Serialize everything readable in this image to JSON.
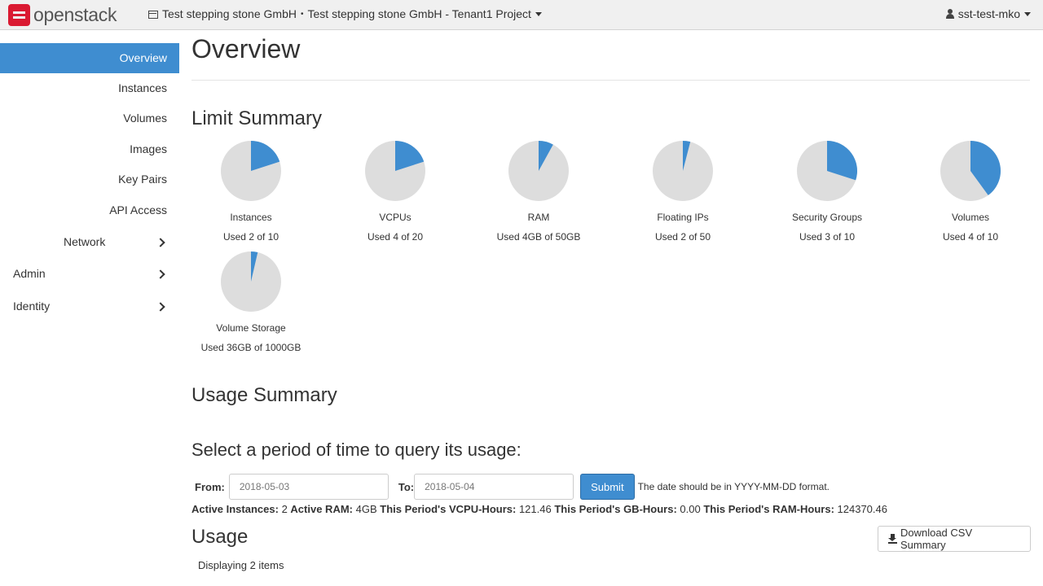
{
  "brand": {
    "logo_text": "openstack"
  },
  "header": {
    "project": "Test stepping stone GmbH",
    "separator": "•",
    "project_detail": "Test stepping stone GmbH - Tenant1 Project",
    "user": "sst-test-mko"
  },
  "sidebar": {
    "items": [
      {
        "label": "Overview",
        "active": true
      },
      {
        "label": "Instances"
      },
      {
        "label": "Volumes"
      },
      {
        "label": "Images"
      },
      {
        "label": "Key Pairs"
      },
      {
        "label": "API Access"
      }
    ],
    "groups": [
      {
        "label": "Network"
      },
      {
        "label": "Admin"
      },
      {
        "label": "Identity"
      }
    ]
  },
  "page": {
    "title": "Overview",
    "limit_summary_title": "Limit Summary",
    "usage_summary_title": "Usage Summary",
    "query_title": "Select a period of time to query its usage:",
    "usage_title": "Usage",
    "displaying": "Displaying 2 items"
  },
  "colors": {
    "accent": "#3f8dd0",
    "pie_bg": "#dddddd"
  },
  "limits": [
    {
      "label": "Instances",
      "used_text": "Used 2 of 10",
      "used": 2,
      "total": 10
    },
    {
      "label": "VCPUs",
      "used_text": "Used 4 of 20",
      "used": 4,
      "total": 20
    },
    {
      "label": "RAM",
      "used_text": "Used 4GB of 50GB",
      "used": 4,
      "total": 50
    },
    {
      "label": "Floating IPs",
      "used_text": "Used 2 of 50",
      "used": 2,
      "total": 50
    },
    {
      "label": "Security Groups",
      "used_text": "Used 3 of 10",
      "used": 3,
      "total": 10
    },
    {
      "label": "Volumes",
      "used_text": "Used 4 of 10",
      "used": 4,
      "total": 10
    },
    {
      "label": "Volume Storage",
      "used_text": "Used 36GB of 1000GB",
      "used": 36,
      "total": 1000
    }
  ],
  "form": {
    "from_label": "From:",
    "from_value": "2018-05-03",
    "to_label": "To:",
    "to_value": "2018-05-04",
    "submit_label": "Submit",
    "hint": "The date should be in YYYY-MM-DD format."
  },
  "stats": {
    "active_instances_label": "Active Instances:",
    "active_instances": "2",
    "active_ram_label": "Active RAM:",
    "active_ram": "4GB",
    "vcpu_hours_label": "This Period's VCPU-Hours:",
    "vcpu_hours": "121.46",
    "gb_hours_label": "This Period's GB-Hours:",
    "gb_hours": "0.00",
    "ram_hours_label": "This Period's RAM-Hours:",
    "ram_hours": "124370.46"
  },
  "actions": {
    "download_csv": "Download CSV Summary"
  }
}
